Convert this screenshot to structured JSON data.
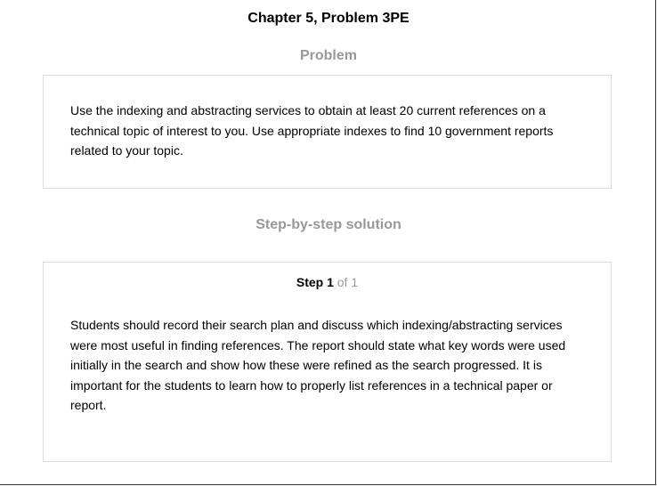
{
  "header": {
    "title": "Chapter 5, Problem 3PE"
  },
  "problem": {
    "heading": "Problem",
    "text": "Use the indexing and abstracting services to obtain at least 20 current references on a technical topic of interest to you. Use appropriate indexes to find 10 government reports related to your topic."
  },
  "solution": {
    "heading": "Step-by-step solution",
    "step_word": "Step 1",
    "step_of": "of 1",
    "text": "Students should record their search plan and discuss which indexing/abstracting services were most useful in finding references. The report should state what key words were used initially in the search and show how these were refined as the search progressed. It is important for the students to learn how to properly list references in a technical paper or report."
  },
  "colors": {
    "heading_gray": "#999999",
    "box_border": "#dddddd",
    "text": "#000000"
  }
}
